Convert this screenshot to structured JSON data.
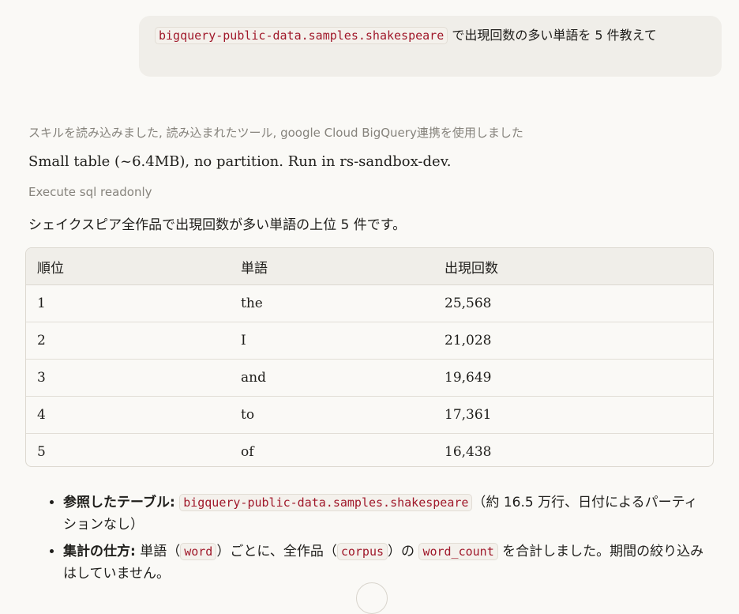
{
  "user_message": {
    "code": "bigquery-public-data.samples.shakespeare",
    "text": " で出現回数の多い単語を 5 件教えて"
  },
  "tool_summary": "スキルを読み込みました, 読み込まれたツール, google Cloud BigQuery連携を使用しました",
  "assistant_line": "Small table (~6.4MB), no partition. Run in rs-sandbox-dev.",
  "tool_action": "Execute sql readonly",
  "intro": "シェイクスピア全作品で出現回数が多い単語の上位 5 件です。",
  "table": {
    "headers": [
      "順位",
      "単語",
      "出現回数"
    ],
    "rows": [
      [
        "1",
        "the",
        "25,568"
      ],
      [
        "2",
        "I",
        "21,028"
      ],
      [
        "3",
        "and",
        "19,649"
      ],
      [
        "4",
        "to",
        "17,361"
      ],
      [
        "5",
        "of",
        "16,438"
      ]
    ]
  },
  "bullets": [
    {
      "label": "参照したテーブル:",
      "code": "bigquery-public-data.samples.shakespeare",
      "text": "（約 16.5 万行、日付によるパーティションなし）"
    },
    {
      "label": "集計の仕方:",
      "text1": " 単語（",
      "code1": "word",
      "text2": "）ごとに、全作品（",
      "code2": "corpus",
      "text3": "）の ",
      "code3": "word_count",
      "text4": " を合計しました。期間の絞り込みはしていません。"
    }
  ]
}
